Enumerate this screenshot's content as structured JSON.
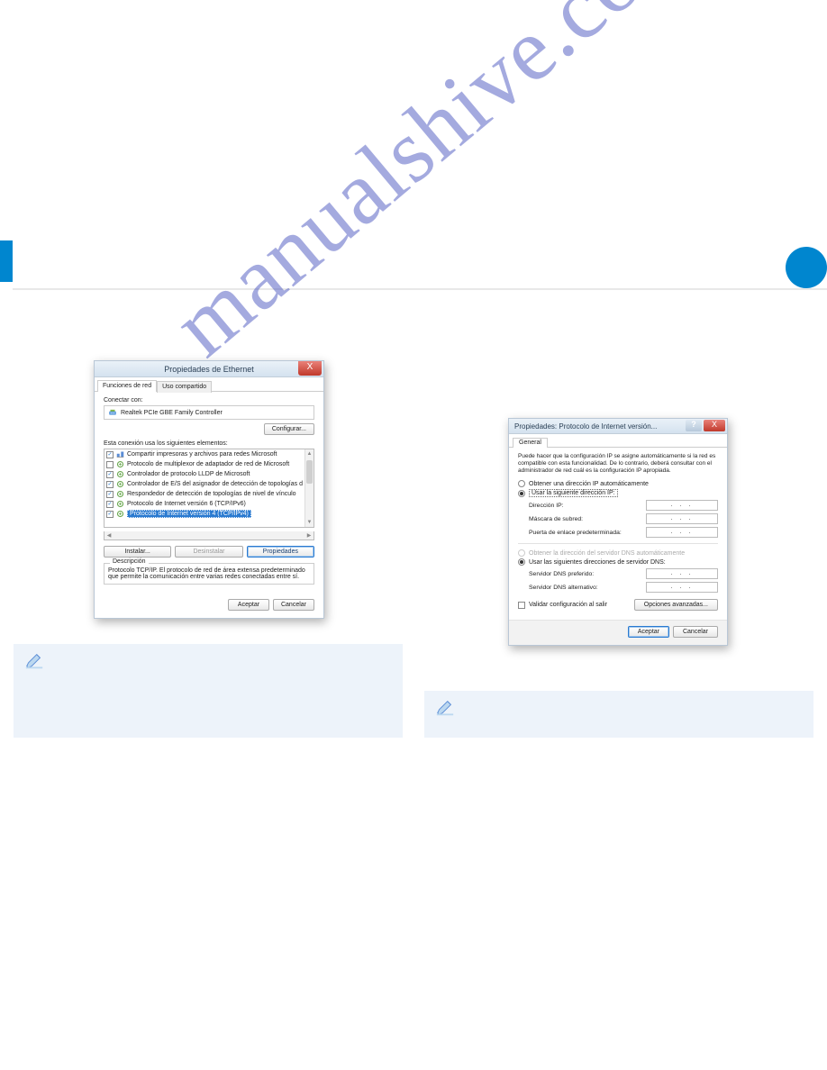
{
  "watermark": "manualshive.com",
  "dialog1": {
    "title": "Propiedades de Ethernet",
    "close_icon": "X",
    "tabs": {
      "active": "Funciones de red",
      "inactive": "Uso compartido"
    },
    "connect_label": "Conectar con:",
    "adapter_name": "Realtek PCIe GBE Family Controller",
    "configure_btn": "Configurar...",
    "elements_label": "Esta conexión usa los siguientes elementos:",
    "items": [
      {
        "checked": true,
        "label": "Compartir impresoras y archivos para redes Microsoft"
      },
      {
        "checked": false,
        "label": "Protocolo de multiplexor de adaptador de red de Microsoft"
      },
      {
        "checked": true,
        "label": "Controlador de protocolo LLDP de Microsoft"
      },
      {
        "checked": true,
        "label": "Controlador de E/S del asignador de detección de topologías d"
      },
      {
        "checked": true,
        "label": "Respondedor de detección de topologías de nivel de vínculo"
      },
      {
        "checked": true,
        "label": "Protocolo de Internet versión 6 (TCP/IPv6)"
      },
      {
        "checked": true,
        "label": "Protocolo de Internet versión 4 (TCP/IPv4)",
        "selected": true
      }
    ],
    "install_btn": "Instalar...",
    "uninstall_btn": "Desinstalar",
    "properties_btn": "Propiedades",
    "desc_legend": "Descripción",
    "desc_text": "Protocolo TCP/IP. El protocolo de red de área extensa predeterminado que permite la comunicación entre varias redes conectadas entre sí.",
    "accept_btn": "Aceptar",
    "cancel_btn": "Cancelar"
  },
  "dialog2": {
    "title": "Propiedades: Protocolo de Internet versión...",
    "help_icon": "?",
    "close_icon": "X",
    "tab": "General",
    "intro": "Puede hacer que la configuración IP se asigne automáticamente si la red es compatible con esta funcionalidad. De lo contrario, deberá consultar con el administrador de red cuál es la configuración IP apropiada.",
    "radio_auto_ip": "Obtener una dirección IP automáticamente",
    "radio_use_ip": "Usar la siguiente dirección IP:",
    "ip_label": "Dirección IP:",
    "mask_label": "Máscara de subred:",
    "gateway_label": "Puerta de enlace predeterminada:",
    "ip_placeholder": ".   .   .",
    "radio_auto_dns": "Obtener la dirección del servidor DNS automáticamente",
    "radio_use_dns": "Usar las siguientes direcciones de servidor DNS:",
    "dns1_label": "Servidor DNS preferido:",
    "dns2_label": "Servidor DNS alternativo:",
    "validate_label": "Validar configuración al salir",
    "advanced_btn": "Opciones avanzadas...",
    "accept_btn": "Aceptar",
    "cancel_btn": "Cancelar"
  }
}
